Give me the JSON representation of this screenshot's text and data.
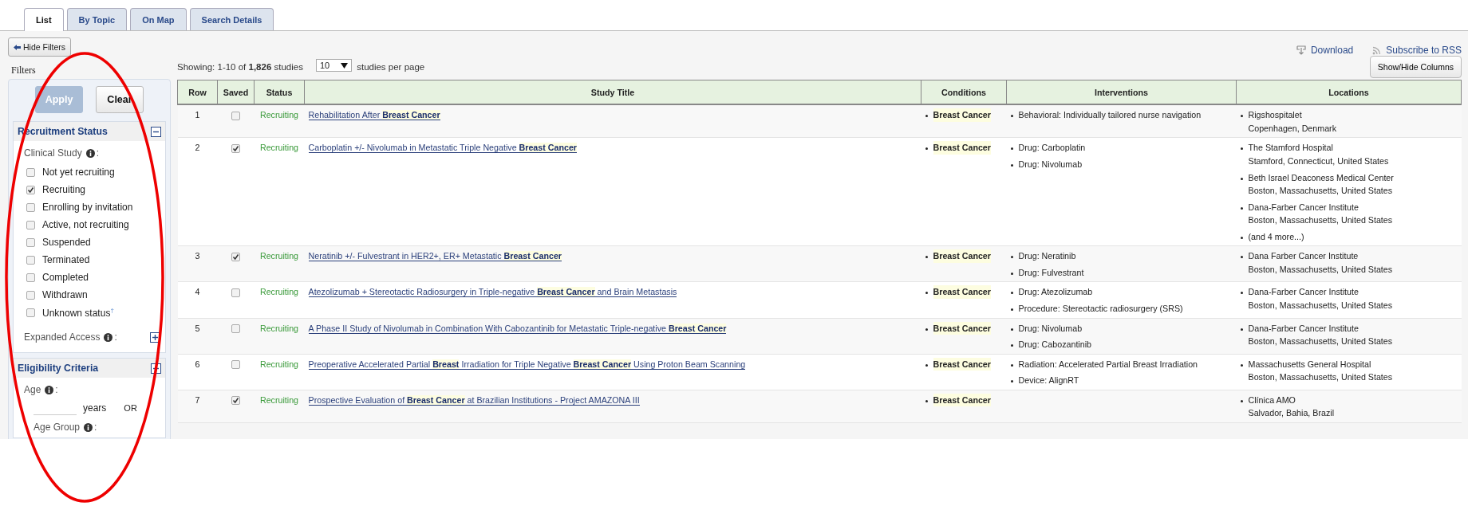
{
  "tabs": [
    {
      "label": "List",
      "selected": true
    },
    {
      "label": "By Topic",
      "selected": false
    },
    {
      "label": "On Map",
      "selected": false
    },
    {
      "label": "Search Details",
      "selected": false
    }
  ],
  "toolbar": {
    "hide_filters": "Hide Filters",
    "download": "Download",
    "rss": "Subscribe to RSS"
  },
  "filters": {
    "legend": "Filters",
    "apply": "Apply",
    "clear": "Clear",
    "sections": [
      {
        "kind": "recruitment",
        "title": "Recruitment Status",
        "expanded": true,
        "group_label": {
          "text": "Clinical Study",
          "suffix": ":"
        },
        "options": [
          {
            "label": "Not yet recruiting",
            "checked": false
          },
          {
            "label": "Recruiting",
            "checked": true
          },
          {
            "label": "Enrolling by invitation",
            "checked": false
          },
          {
            "label": "Active, not recruiting",
            "checked": false
          },
          {
            "label": "Suspended",
            "checked": false
          },
          {
            "label": "Terminated",
            "checked": false
          },
          {
            "label": "Completed",
            "checked": false
          },
          {
            "label": "Withdrawn",
            "checked": false
          },
          {
            "label": "Unknown status$^{†}$",
            "checked": false
          }
        ],
        "subsection": {
          "label": {
            "text": "Expanded Access",
            "suffix": ":"
          },
          "expanded": false
        }
      },
      {
        "kind": "eligibility",
        "title": "Eligibility Criteria",
        "expanded": true,
        "age_label": {
          "text": "Age",
          "suffix": ":"
        },
        "years": "years",
        "or": "OR",
        "age_group_label": {
          "text": "Age Group",
          "suffix": ":"
        }
      }
    ]
  },
  "results": {
    "showing": "Showing: 1-10 of **1,826** studies",
    "per_page": "10",
    "per_page_label": "studies per page",
    "show_hide": "Show/Hide Columns"
  },
  "table": {
    "columns": [
      "Row",
      "Saved",
      "Status",
      "Study Title",
      "Conditions",
      "Interventions",
      "Locations"
    ],
    "rows": [
      {
        "row": "1",
        "saved": false,
        "status": "Recruiting",
        "title": "Rehabilitation After **Breast Cancer**",
        "conditions": [
          "Breast Cancer"
        ],
        "interventions": [
          "Behavioral: Individually tailored nurse navigation"
        ],
        "locations": [
          {
            "name": "Rigshospitalet",
            "place": "Copenhagen, Denmark"
          }
        ]
      },
      {
        "row": "2",
        "saved": true,
        "status": "Recruiting",
        "title": "Carboplatin +/- Nivolumab in Metastatic Triple Negative **Breast Cancer**",
        "conditions": [
          "Breast Cancer"
        ],
        "interventions": [
          "Drug: Carboplatin",
          "Drug: Nivolumab"
        ],
        "locations": [
          {
            "name": "The Stamford Hospital",
            "place": "Stamford, Connecticut, United States"
          },
          {
            "name": "Beth Israel Deaconess Medical Center",
            "place": "Boston, Massachusetts, United States"
          },
          {
            "name": "Dana-Farber Cancer Institute",
            "place": "Boston, Massachusetts, United States"
          },
          {
            "name": "(and 4 more...)"
          }
        ]
      },
      {
        "row": "3",
        "saved": true,
        "status": "Recruiting",
        "title": "Neratinib +/- Fulvestrant in HER2+, ER+ Metastatic **Breast Cancer**",
        "conditions": [
          "Breast Cancer"
        ],
        "interventions": [
          "Drug: Neratinib",
          "Drug: Fulvestrant"
        ],
        "locations": [
          {
            "name": "Dana Farber Cancer Institute",
            "place": "Boston, Massachusetts, United States"
          }
        ]
      },
      {
        "row": "4",
        "saved": false,
        "status": "Recruiting",
        "title": "Atezolizumab + Stereotactic Radiosurgery in Triple-negative **Breast Cancer** and Brain Metastasis",
        "conditions": [
          "Breast Cancer"
        ],
        "interventions": [
          "Drug: Atezolizumab",
          "Procedure: Stereotactic radiosurgery (SRS)"
        ],
        "locations": [
          {
            "name": "Dana-Farber Cancer Institute",
            "place": "Boston, Massachusetts, United States"
          }
        ]
      },
      {
        "row": "5",
        "saved": false,
        "status": "Recruiting",
        "title": "A Phase II Study of Nivolumab in Combination With Cabozantinib for Metastatic Triple-negative **Breast Cancer**",
        "conditions": [
          "Breast Cancer"
        ],
        "interventions": [
          "Drug: Nivolumab",
          "Drug: Cabozantinib"
        ],
        "locations": [
          {
            "name": "Dana-Farber Cancer Institute",
            "place": "Boston, Massachusetts, United States"
          }
        ]
      },
      {
        "row": "6",
        "saved": false,
        "status": "Recruiting",
        "title": "Preoperative Accelerated Partial **Breast** Irradiation for Triple Negative **Breast Cancer** Using Proton Beam Scanning",
        "conditions": [
          "Breast Cancer"
        ],
        "interventions": [
          "Radiation: Accelerated Partial Breast Irradiation",
          "Device: AlignRT"
        ],
        "locations": [
          {
            "name": "Massachusetts General Hospital",
            "place": "Boston, Massachusetts, United States"
          }
        ]
      },
      {
        "row": "7",
        "saved": true,
        "status": "Recruiting",
        "title": "Prospective Evaluation of **Breast Cancer** at Brazilian Institutions - Project AMAZONA III",
        "conditions": [
          "Breast Cancer"
        ],
        "interventions": [],
        "locations": [
          {
            "name": "Clínica AMO",
            "place": "Salvador, Bahia, Brazil"
          }
        ]
      }
    ]
  }
}
